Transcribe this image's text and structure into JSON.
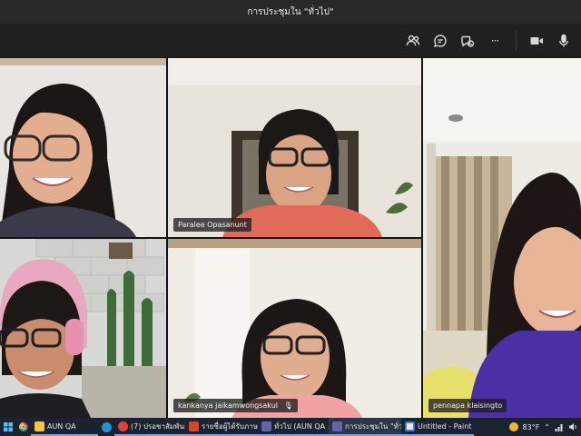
{
  "window": {
    "title": "การประชุมใน \"ทั่วไป\""
  },
  "toolbar": {
    "icons": [
      "participants-icon",
      "chat-icon",
      "reactions-icon",
      "more-icon",
      "camera-icon",
      "mic-icon"
    ],
    "more_label": "···"
  },
  "participants": [
    {
      "name": "",
      "position": "top-left"
    },
    {
      "name": "Paralee Opasanunt",
      "position": "top-center"
    },
    {
      "name": "",
      "position": "top-right-tall"
    },
    {
      "name": "",
      "position": "bottom-left"
    },
    {
      "name": "kankanya jaikamwongsakul",
      "position": "bottom-center"
    },
    {
      "name": "pennapa klaisingto",
      "position": "bottom-right"
    }
  ],
  "taskbar": {
    "items": [
      {
        "label": "",
        "icon": "windows-icon"
      },
      {
        "label": "",
        "icon": "chrome-icon"
      },
      {
        "label": "AUN QA",
        "icon": "folder-icon"
      },
      {
        "label": "",
        "icon": "edge-icon"
      },
      {
        "label": "(7) ปรอชาสัมพันธ์ ...",
        "icon": "chrome-icon"
      },
      {
        "label": "รายชื่อผู้ได้รับภาษ...",
        "icon": "powerpoint-icon"
      },
      {
        "label": "ทั่วไป (AUN QA ...",
        "icon": "teams-icon"
      },
      {
        "label": "การประชุมใน \"ทั่ว...",
        "icon": "teams-icon"
      },
      {
        "label": "Untitled - Paint",
        "icon": "paint-icon"
      }
    ],
    "tray": {
      "weather": "83°F",
      "icons": [
        "weather-icon",
        "chevron-up-icon",
        "network-icon",
        "volume-icon"
      ]
    }
  },
  "colors": {
    "accent": "#7aa7e0",
    "titlebar": "#292929",
    "taskbar": "#1b2330"
  }
}
